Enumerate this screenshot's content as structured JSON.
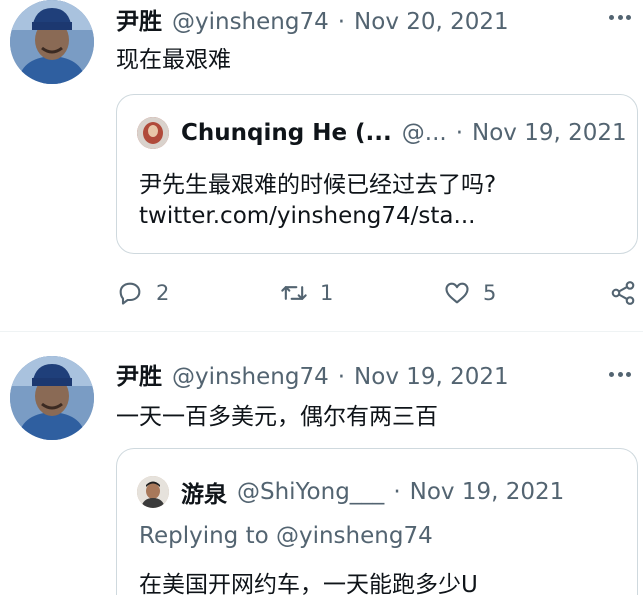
{
  "tweets": [
    {
      "author": {
        "name": "尹胜",
        "handle": "@yinsheng74",
        "date": "Nov 20, 2021"
      },
      "text": "现在最艰难",
      "quote": {
        "author": {
          "name": "Chunqing He (...",
          "handle": "@...",
          "date": "Nov 19, 2021"
        },
        "lines": [
          "尹先生最艰难的时候已经过去了吗?",
          "twitter.com/yinsheng74/sta..."
        ]
      },
      "actions": {
        "replies": "2",
        "retweets": "1",
        "likes": "5"
      }
    },
    {
      "author": {
        "name": "尹胜",
        "handle": "@yinsheng74",
        "date": "Nov 19, 2021"
      },
      "text": "一天一百多美元，偶尔有两三百",
      "quote": {
        "author": {
          "name": "游泉",
          "handle": "@ShiYong___",
          "date": "Nov 19, 2021"
        },
        "replying": "Replying to @yinsheng74",
        "lines": [
          "在美国开网约车，一天能跑多少U"
        ]
      }
    }
  ],
  "separator": "·",
  "colors": {
    "text": "#0f1419",
    "secondary": "#536471",
    "border": "#cfd9de"
  },
  "icons": [
    "more-icon",
    "reply-icon",
    "retweet-icon",
    "like-icon",
    "share-icon"
  ]
}
